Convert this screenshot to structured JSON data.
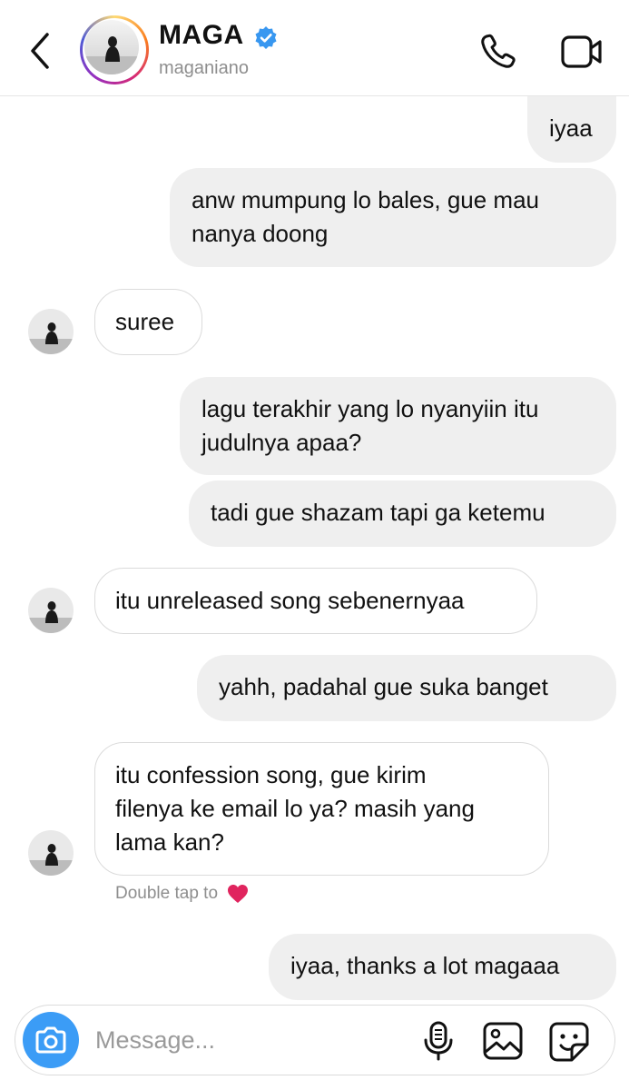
{
  "header": {
    "name": "MAGA",
    "handle": "maganiano",
    "verified": true,
    "icons": {
      "back": "chevron-left-icon",
      "call": "phone-icon",
      "video": "video-camera-icon",
      "verified": "verified-badge-icon"
    }
  },
  "messages": [
    {
      "side": "sent",
      "text": "iyaa"
    },
    {
      "side": "sent",
      "line1": "anw mumpung lo bales, gue mau",
      "line2": "nanya doong"
    },
    {
      "side": "received",
      "text": "suree"
    },
    {
      "side": "sent",
      "line1": "lagu terakhir yang lo nyanyiin itu",
      "line2": "judulnya apaa?"
    },
    {
      "side": "sent",
      "text": "tadi gue shazam tapi ga ketemu"
    },
    {
      "side": "received",
      "text": "itu unreleased song sebenernyaa"
    },
    {
      "side": "sent",
      "text": "yahh, padahal gue suka banget"
    },
    {
      "side": "received",
      "line1": "itu confession song, gue kirim",
      "line2": "filenya ke email lo ya? masih yang",
      "line3": "lama kan?"
    },
    {
      "side": "sent",
      "text": "iyaa, thanks a lot magaaa"
    }
  ],
  "hint": {
    "text": "Double tap to",
    "icon": "heart-icon",
    "color": "#e0245e"
  },
  "composer": {
    "placeholder": "Message...",
    "accent": "#3b9cf6",
    "icons": {
      "camera": "camera-icon",
      "mic": "microphone-icon",
      "gallery": "image-gallery-icon",
      "sticker": "sticker-icon"
    }
  }
}
